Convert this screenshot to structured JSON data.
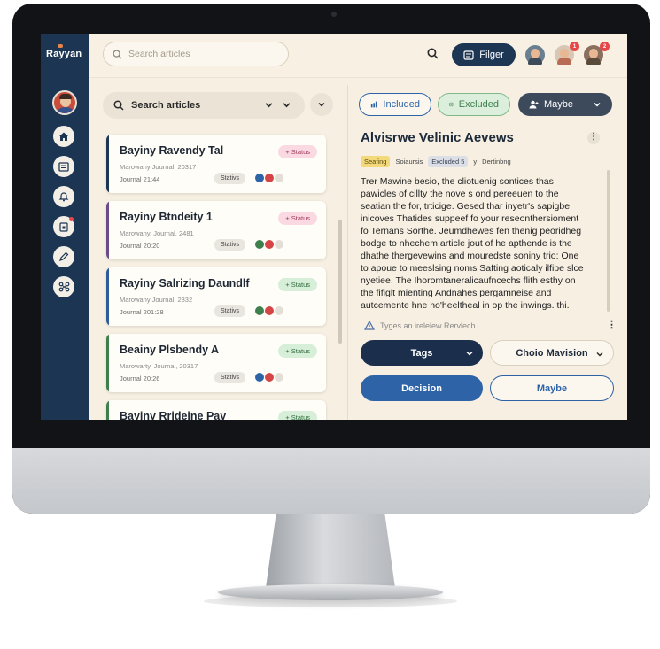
{
  "app": {
    "logo": "Rayyan"
  },
  "header": {
    "search_placeholder": "Search articles",
    "filter_label": "Filger",
    "notification_badges": [
      "1",
      "2"
    ]
  },
  "list": {
    "search_label": "Search articles",
    "articles": [
      {
        "title": "Bayiny Ravendy Tal",
        "journal": "Marowany Journal, 20317",
        "date": "Journal 21:44",
        "status": "+ Status",
        "status_kind": "pink",
        "stat_label": "Stativs",
        "stripe_color": "#1d3654"
      },
      {
        "title": "Rayiny Btndeity 1",
        "journal": "Marowany, Journal, 2481",
        "date": "Journal 20:20",
        "status": "+ Status",
        "status_kind": "pink",
        "stat_label": "Stativs",
        "stripe_color": "#6b4b8a"
      },
      {
        "title": "Rayiny Salrizing Daundlf",
        "journal": "Marowany Journal, 2832",
        "date": "Journal 201:28",
        "status": "+ Status",
        "status_kind": "green",
        "stat_label": "Stativs",
        "stripe_color": "#2f5d9a"
      },
      {
        "title": "Beainy Plsbendy A",
        "journal": "Marowarty, Journal, 20317",
        "date": "Journal 20:26",
        "status": "+ Status",
        "status_kind": "green",
        "stat_label": "Stativs",
        "stripe_color": "#3f7f4d"
      },
      {
        "title": "Bayiny Rrideine Pay",
        "journal": "",
        "date": "",
        "status": "+ Status",
        "status_kind": "green",
        "stat_label": "",
        "stripe_color": "#3f7f4d"
      }
    ]
  },
  "detail": {
    "tabs": {
      "included": "Included",
      "excluded": "Excluded",
      "maybe": "Maybe"
    },
    "title": "Alvisrwe Velinic Aevews",
    "meta": {
      "tag1": "Seafing",
      "tag2": "Soiaursis",
      "tag3": "Excluded 5",
      "sep": "y",
      "tag4": "Dertinbng"
    },
    "abstract_lines": [
      "Trer Mawine besio, the cliotuenig sontices thas",
      "pawicles of cillty the nove s ond pereeuen to the",
      "seatian the for, trticige. Gesed thar inyetr's sapigbe",
      "inicoves Thatides suppeef fo your reseonthersioment",
      "fo Ternans Sorthe. Jeumdhewes fen thenig peoridheg",
      "bodge to nhechem article jout of he apthende is the",
      "dhathe thergevewins and mouredste soniny trio: One",
      "to apoue to meeslsing noms Safting aoticaly ilfibe slce",
      "nyetiee. The Ihoromtaneralicaufncechs flith esthy on",
      "the fifiglt mienting Andnahes pergamneise and",
      "autcemente hne no'heeltheal in op the inwings. thi."
    ],
    "review_hint": "Tyges an irelelew Rervlech",
    "actions": {
      "tags": "Tags",
      "choice": "Choio Mavision",
      "decision": "Decision",
      "maybe": "Maybe"
    }
  },
  "colors": {
    "navy": "#1d3654",
    "decision_blue": "#2e63a8",
    "accent_orange": "#e8834a",
    "background": "#f6efe2"
  },
  "icons": {
    "nav": [
      "home-icon",
      "list-icon",
      "bell-icon",
      "calendar-icon",
      "pencil-icon",
      "network-icon"
    ],
    "header": [
      "search-icon",
      "filter-icon"
    ]
  }
}
